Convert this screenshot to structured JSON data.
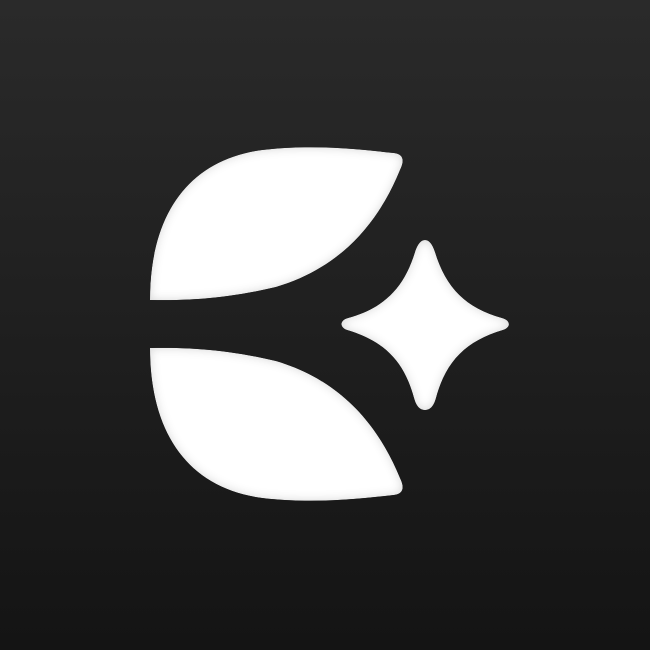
{
  "icon": {
    "name": "leaf-and-sparkle-logo",
    "colors": {
      "background_top": "#2a2a2a",
      "background_bottom": "#141414",
      "glyph": "#ffffff"
    }
  }
}
